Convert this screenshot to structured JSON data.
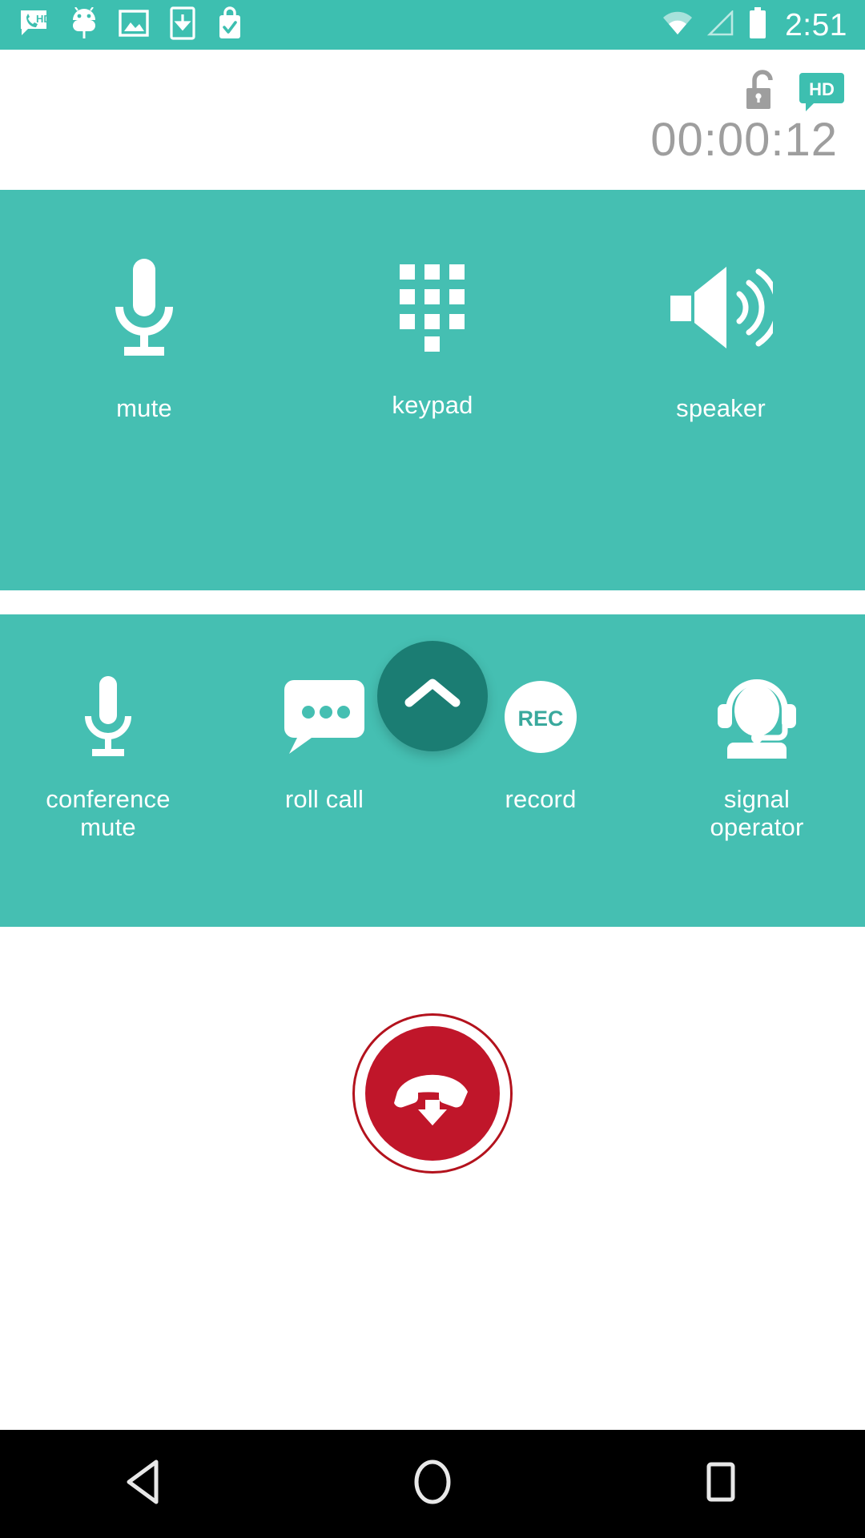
{
  "status_bar": {
    "time": "2:51",
    "left_icons": [
      {
        "name": "hd-call-icon",
        "label": "HD"
      },
      {
        "name": "android-bot-icon",
        "label": "android"
      },
      {
        "name": "screenshot-image-icon",
        "label": "image"
      },
      {
        "name": "download-to-device-icon",
        "label": "download"
      },
      {
        "name": "work-briefcase-check-icon",
        "label": "work"
      }
    ],
    "right_icons": [
      {
        "name": "wifi-icon",
        "label": "wifi"
      },
      {
        "name": "signal-icon",
        "label": "signal"
      },
      {
        "name": "battery-icon",
        "label": "battery"
      }
    ],
    "background": "#3dbfb0",
    "foreground": "#ffffff"
  },
  "call_header": {
    "timer": "00:00:12",
    "timer_color": "#9e9e9e",
    "lock_icon_name": "unlock-icon",
    "hd_badge_label": "HD",
    "hd_badge_color": "#3dbfb0"
  },
  "panel": {
    "background": "#45bfb2",
    "expand_button": {
      "name": "expand-call-options-button",
      "icon": "chevron-up-icon",
      "color": "#1b7d73"
    },
    "primary_controls": [
      {
        "label": "mute",
        "icon": "microphone-icon"
      },
      {
        "label": "keypad",
        "icon": "dialpad-icon"
      },
      {
        "label": "speaker",
        "icon": "speaker-icon"
      }
    ],
    "secondary_controls": [
      {
        "label": "conference\nmute",
        "line1": "conference",
        "line2": "mute",
        "icon": "microphone-icon"
      },
      {
        "label": "roll call",
        "line1": "roll call",
        "line2": "",
        "icon": "speech-bubble-icon"
      },
      {
        "label": "record",
        "line1": "record",
        "line2": "",
        "icon": "record-icon",
        "badge_text": "REC"
      },
      {
        "label": "signal\noperator",
        "line1": "signal",
        "line2": "operator",
        "icon": "headset-operator-icon"
      }
    ]
  },
  "end_call": {
    "name": "end-call-button",
    "icon": "hang-up-phone-icon",
    "color": "#c0162a",
    "ring_color": "#b3121d"
  },
  "nav_bar": {
    "background": "#000000",
    "buttons": [
      {
        "name": "nav-back-button",
        "icon": "triangle-back-icon"
      },
      {
        "name": "nav-home-button",
        "icon": "circle-home-icon"
      },
      {
        "name": "nav-recents-button",
        "icon": "square-recents-icon"
      }
    ]
  }
}
